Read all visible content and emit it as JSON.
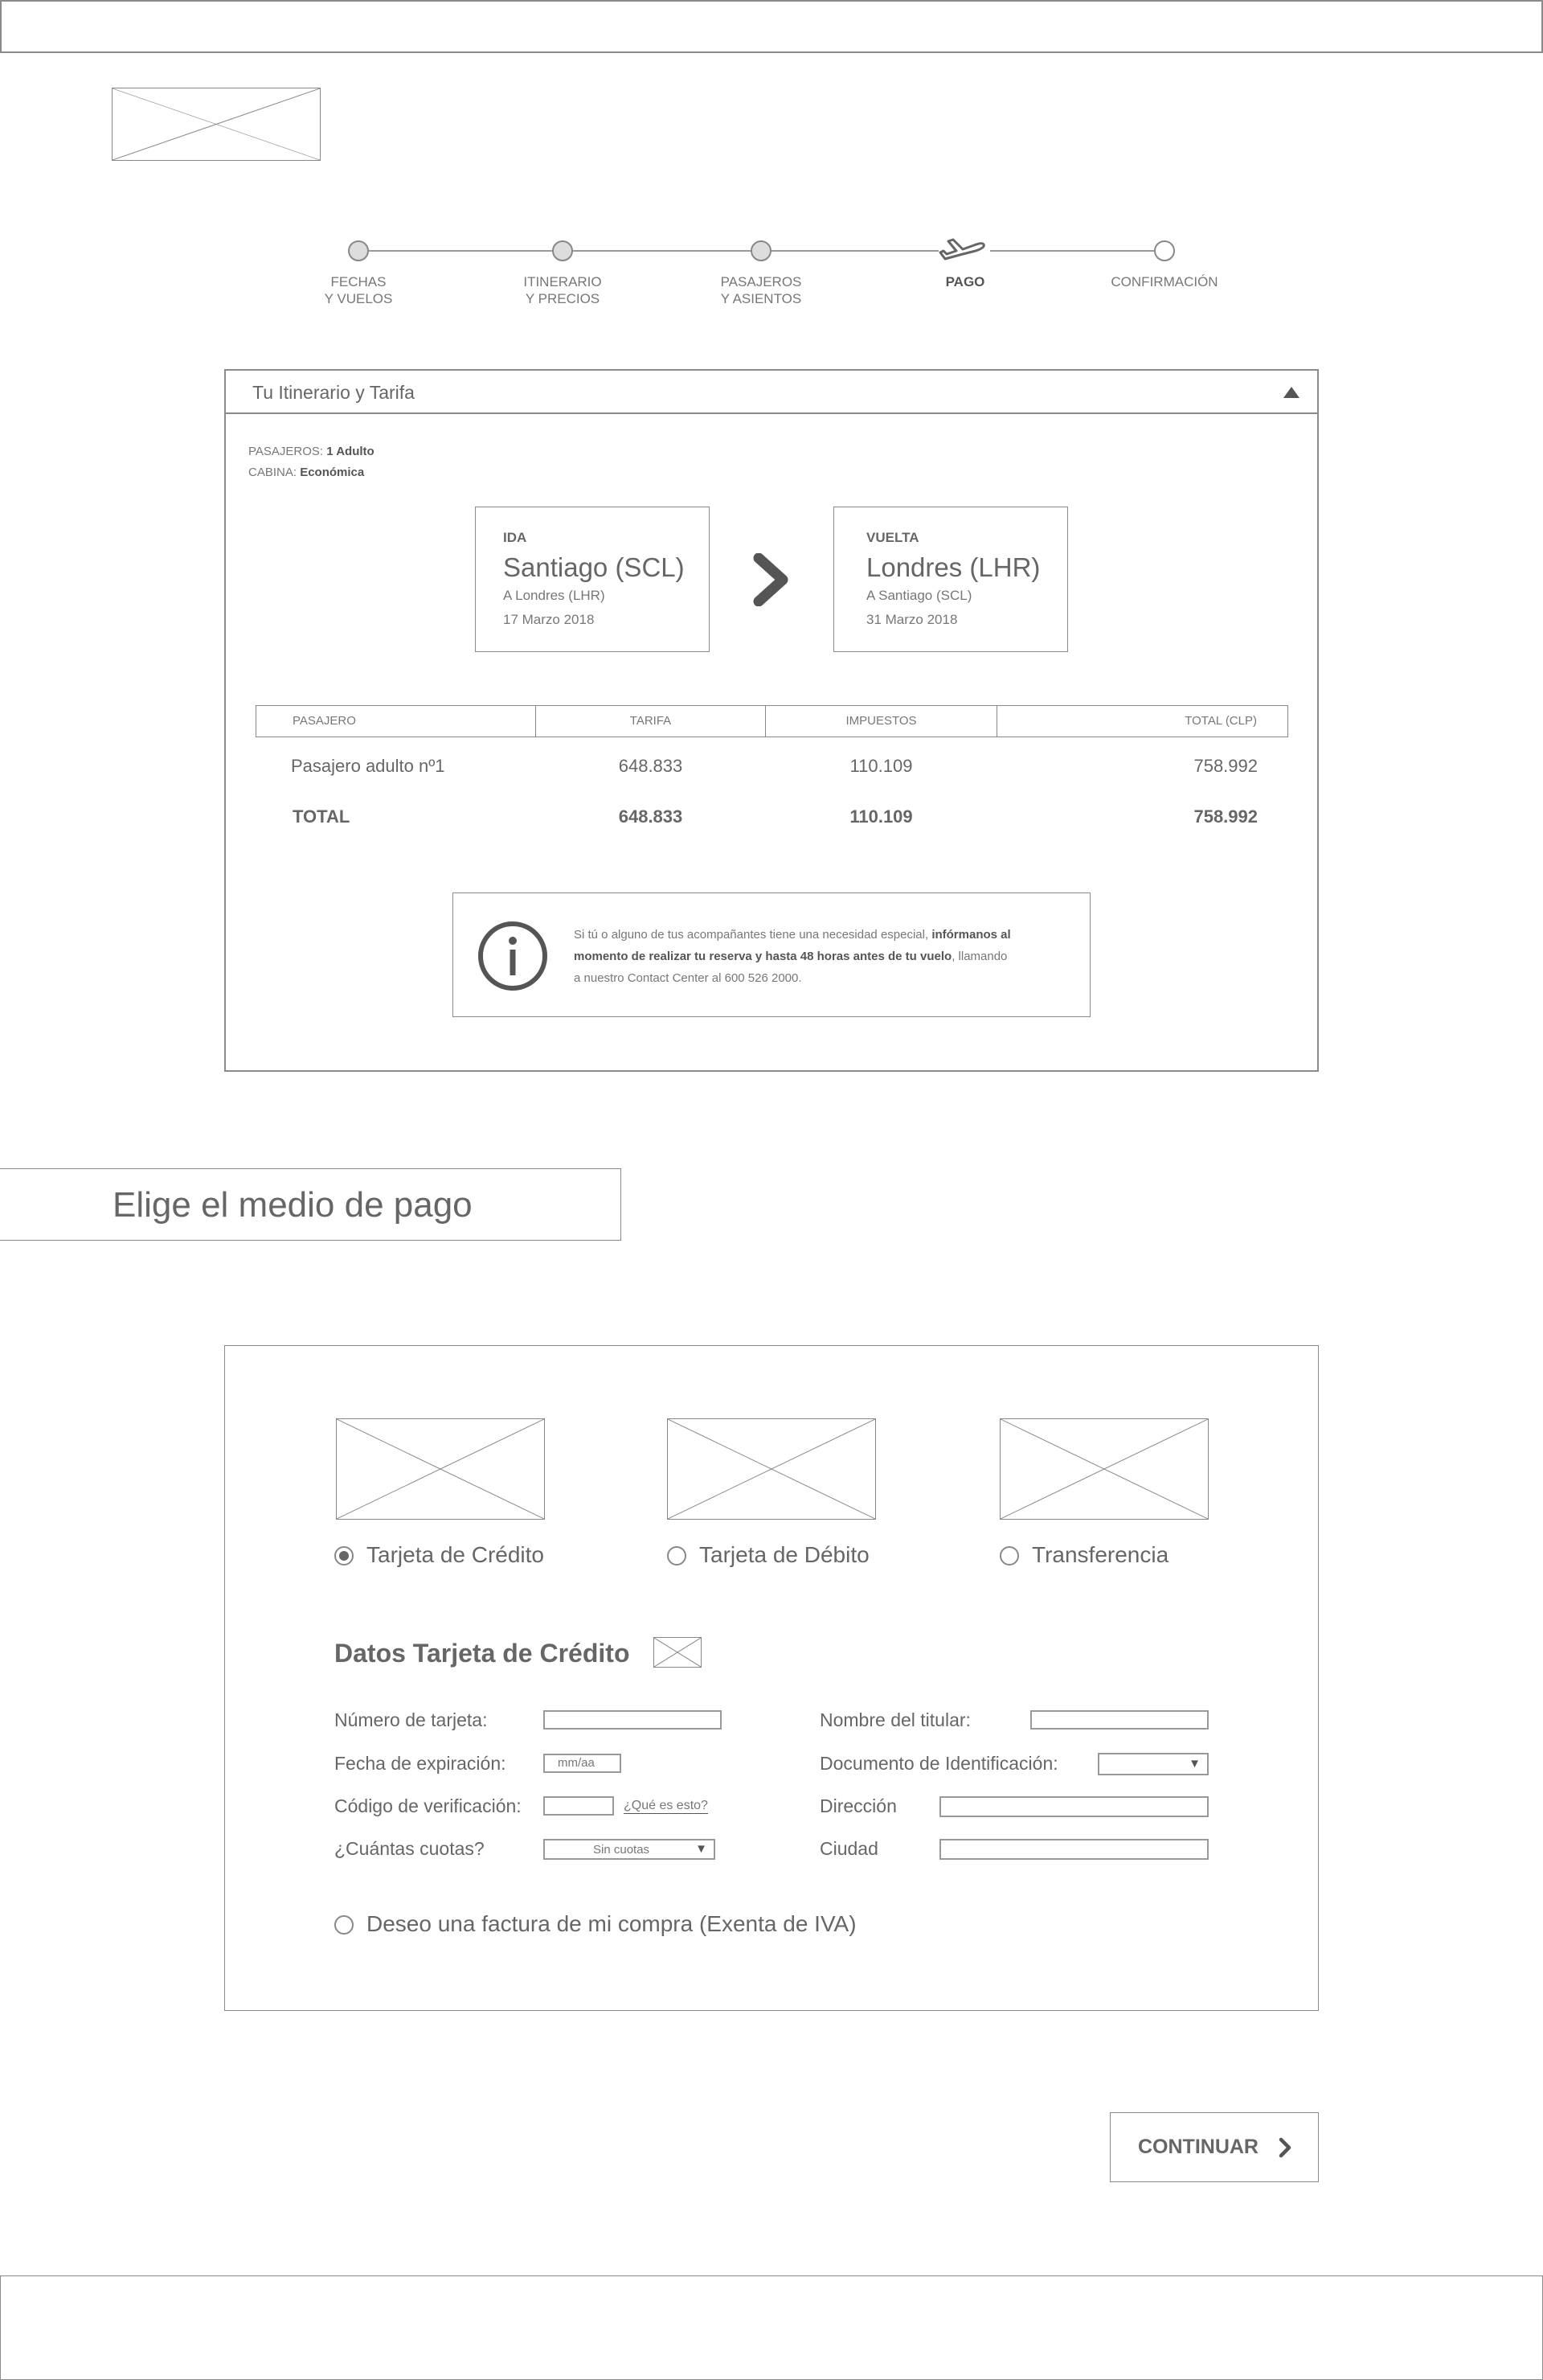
{
  "stepper": {
    "steps": [
      {
        "line1": "FECHAS",
        "line2": "Y VUELOS",
        "state": "done"
      },
      {
        "line1": "ITINERARIO",
        "line2": "Y PRECIOS",
        "state": "done"
      },
      {
        "line1": "PASAJEROS",
        "line2": "Y ASIENTOS",
        "state": "done"
      },
      {
        "line1": "PAGO",
        "line2": "",
        "state": "current"
      },
      {
        "line1": "CONFIRMACIÓN",
        "line2": "",
        "state": "pending"
      }
    ]
  },
  "itinerary": {
    "title": "Tu Itinerario y Tarifa",
    "passengers_label": "PASAJEROS:",
    "passengers_value": "1 Adulto",
    "cabin_label": "CABINA:",
    "cabin_value": "Económica",
    "outbound": {
      "tag": "IDA",
      "city": "Santiago (SCL)",
      "dest": "A Londres (LHR)",
      "date": "17 Marzo 2018"
    },
    "return": {
      "tag": "VUELTA",
      "city": "Londres (LHR)",
      "dest": "A Santiago (SCL)",
      "date": "31 Marzo 2018"
    },
    "table": {
      "headers": [
        "PASAJERO",
        "TARIFA",
        "IMPUESTOS",
        "TOTAL (CLP)"
      ],
      "rows": [
        [
          "Pasajero adulto nº1",
          "648.833",
          "110.109",
          "758.992"
        ]
      ],
      "total": [
        "TOTAL",
        "648.833",
        "110.109",
        "758.992"
      ]
    },
    "info": {
      "text1": "Si tú o alguno de tus acompañantes tiene una necesidad especial, ",
      "bold1": "infórmanos al",
      "bold2": "momento de realizar tu reserva y hasta 48 horas antes de tu vuelo",
      "text2": ", llamando",
      "text3": "a nuestro Contact Center al 600 526 2000."
    }
  },
  "payment": {
    "section_title": "Elige el medio de pago",
    "methods": [
      {
        "label": "Tarjeta de Crédito",
        "selected": true
      },
      {
        "label": "Tarjeta de Débito",
        "selected": false
      },
      {
        "label": "Transferencia",
        "selected": false
      }
    ],
    "card_title": "Datos Tarjeta de Crédito",
    "fields": {
      "card_number": "Número de tarjeta:",
      "expiry": "Fecha de expiración:",
      "expiry_placeholder": "mm/aa",
      "cvv": "Código de verificación:",
      "cvv_help": "¿Qué es esto?",
      "installments": "¿Cuántas cuotas?",
      "installments_value": "Sin cuotas",
      "holder": "Nombre del titular:",
      "id_doc": "Documento de Identificación:",
      "address": "Dirección",
      "city": "Ciudad"
    },
    "invoice_label": "Deseo una factura de mi compra (Exenta de IVA)"
  },
  "continue_label": "CONTINUAR"
}
